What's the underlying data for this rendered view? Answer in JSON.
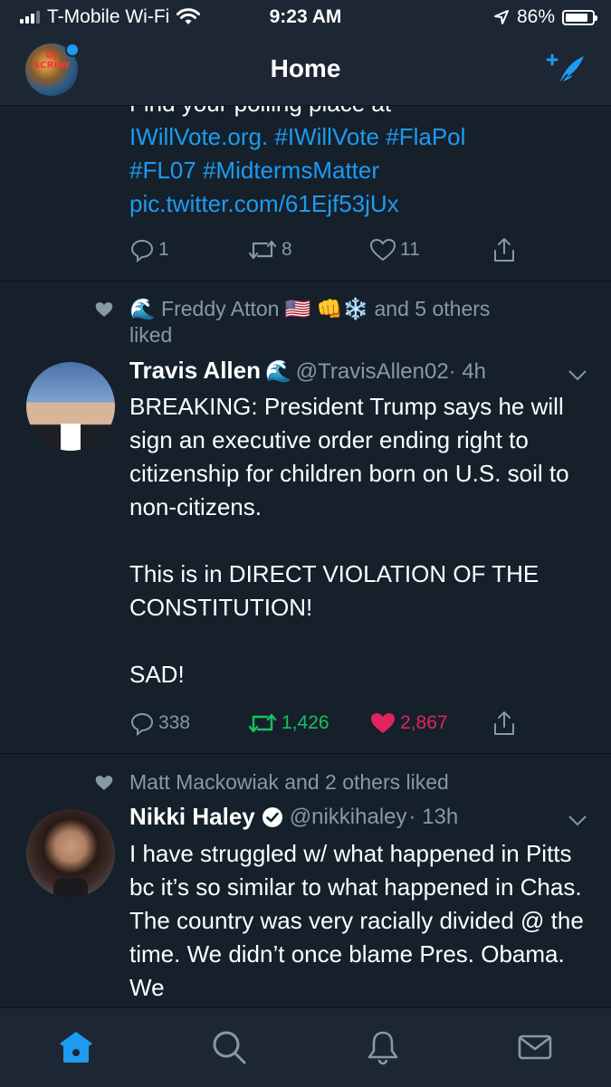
{
  "status_bar": {
    "carrier": "T-Mobile Wi-Fi",
    "time": "9:23 AM",
    "battery": "86%",
    "battery_level": 0.86
  },
  "header": {
    "title": "Home",
    "avatar_text": "DJ SCREW",
    "compose_icon": "compose-feather-icon"
  },
  "tweets": [
    {
      "partial_line": "Find your polling place at",
      "text_links": [
        "IWillVote.org.",
        "#IWillVote",
        "#FlaPol",
        "#FL07",
        "#MidtermsMatter",
        "pic.twitter.com/61Ejf53jUx"
      ],
      "replies": "1",
      "retweets": "8",
      "likes": "11"
    },
    {
      "liked_by": "🌊 Freddy Atton 🇺🇸 👊❄️ and 5 others liked",
      "name": "Travis Allen",
      "name_emoji": "🌊",
      "handle": "@TravisAllen02",
      "time": "· 4h",
      "text_1": "BREAKING: President Trump says he will sign an executive order ending right to citizenship for children born on U.S. soil to non-citizens.",
      "text_2": "This is in DIRECT VIOLATION OF THE CONSTITUTION!",
      "text_3": "SAD!",
      "replies": "338",
      "retweets": "1,426",
      "likes": "2,867",
      "retweet_color": "#17bf63",
      "like_color": "#e0245e"
    },
    {
      "liked_by": "Matt Mackowiak and 2 others liked",
      "name": "Nikki Haley",
      "handle": "@nikkihaley",
      "time": "· 13h",
      "text": "I have struggled w/ what happened in Pitts bc it’s so similar to what happened in Chas. The country was very racially divided @ the time. We didn’t once blame Pres. Obama. We"
    }
  ],
  "tab_bar": {
    "items": [
      "home-icon",
      "search-icon",
      "notifications-icon",
      "messages-icon"
    ],
    "active_color": "#1d9bf0"
  },
  "colors": {
    "background": "#15202b",
    "bar": "#1c2733",
    "link": "#1d9bf0",
    "muted": "#8899a6"
  }
}
